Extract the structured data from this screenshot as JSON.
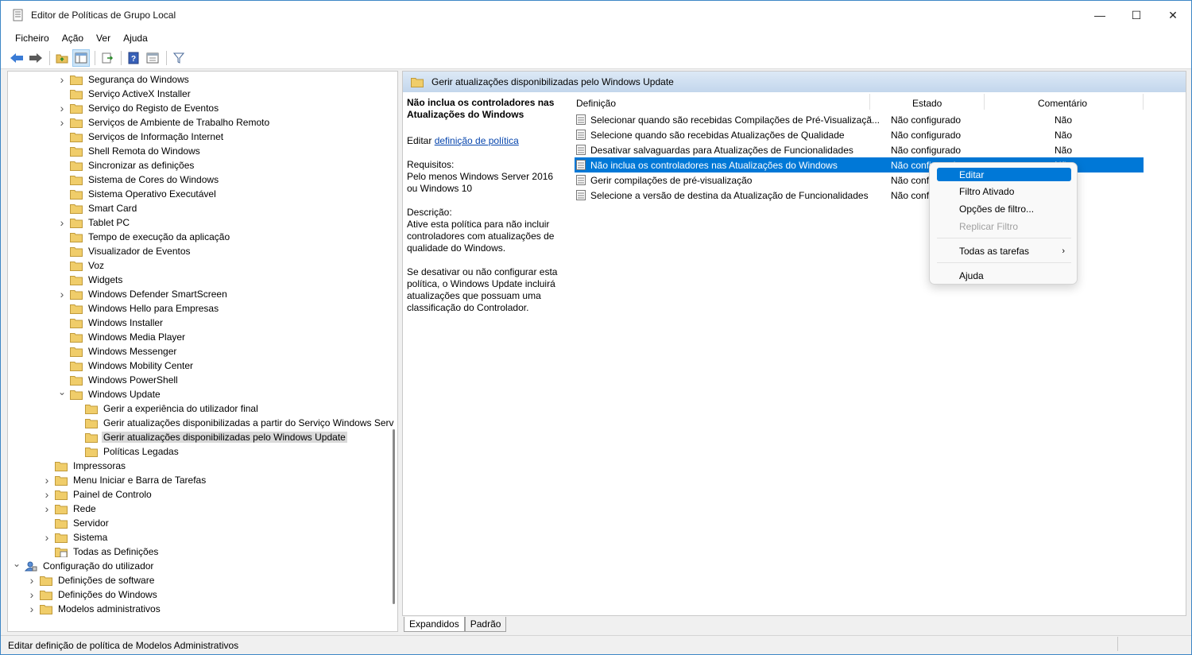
{
  "window": {
    "title": "Editor de Políticas de Grupo Local",
    "controls": [
      "—",
      "☐",
      "✕"
    ]
  },
  "menubar": {
    "items": [
      "Ficheiro",
      "Ação",
      "Ver",
      "Ajuda"
    ]
  },
  "tree": {
    "items": [
      {
        "label": "Segurança do Windows",
        "expandable": true,
        "level": 3
      },
      {
        "label": "Serviço ActiveX Installer",
        "expandable": false,
        "level": 3
      },
      {
        "label": "Serviço do Registo de Eventos",
        "expandable": true,
        "level": 3
      },
      {
        "label": "Serviços de Ambiente de Trabalho Remoto",
        "expandable": true,
        "level": 3
      },
      {
        "label": "Serviços de Informação Internet",
        "expandable": false,
        "level": 3
      },
      {
        "label": "Shell Remota do Windows",
        "expandable": false,
        "level": 3
      },
      {
        "label": "Sincronizar as definições",
        "expandable": false,
        "level": 3
      },
      {
        "label": "Sistema de Cores do Windows",
        "expandable": false,
        "level": 3
      },
      {
        "label": "Sistema Operativo Executável",
        "expandable": false,
        "level": 3
      },
      {
        "label": "Smart Card",
        "expandable": false,
        "level": 3
      },
      {
        "label": "Tablet PC",
        "expandable": true,
        "level": 3
      },
      {
        "label": "Tempo de execução da aplicação",
        "expandable": false,
        "level": 3
      },
      {
        "label": "Visualizador de Eventos",
        "expandable": false,
        "level": 3
      },
      {
        "label": "Voz",
        "expandable": false,
        "level": 3
      },
      {
        "label": "Widgets",
        "expandable": false,
        "level": 3
      },
      {
        "label": "Windows Defender SmartScreen",
        "expandable": true,
        "level": 3
      },
      {
        "label": "Windows Hello para Empresas",
        "expandable": false,
        "level": 3
      },
      {
        "label": "Windows Installer",
        "expandable": false,
        "level": 3
      },
      {
        "label": "Windows Media Player",
        "expandable": false,
        "level": 3
      },
      {
        "label": "Windows Messenger",
        "expandable": false,
        "level": 3
      },
      {
        "label": "Windows Mobility Center",
        "expandable": false,
        "level": 3
      },
      {
        "label": "Windows PowerShell",
        "expandable": false,
        "level": 3
      },
      {
        "label": "Windows Update",
        "expandable": true,
        "expanded": true,
        "level": 3
      },
      {
        "label": "Gerir a experiência do utilizador final",
        "expandable": false,
        "level": 4
      },
      {
        "label": "Gerir atualizações disponibilizadas a partir do Serviço Windows Serv",
        "expandable": false,
        "level": 4
      },
      {
        "label": "Gerir atualizações disponibilizadas pelo Windows Update",
        "expandable": false,
        "level": 4,
        "selected": true
      },
      {
        "label": "Políticas Legadas",
        "expandable": false,
        "level": 4
      },
      {
        "label": "Impressoras",
        "expandable": false,
        "level": 2
      },
      {
        "label": "Menu Iniciar e Barra de Tarefas",
        "expandable": true,
        "level": 2
      },
      {
        "label": "Painel de Controlo",
        "expandable": true,
        "level": 2
      },
      {
        "label": "Rede",
        "expandable": true,
        "level": 2
      },
      {
        "label": "Servidor",
        "expandable": false,
        "level": 2
      },
      {
        "label": "Sistema",
        "expandable": true,
        "level": 2
      },
      {
        "label": "Todas as Definições",
        "expandable": false,
        "level": 2,
        "icon": "settings-folder-icon"
      },
      {
        "label": "Configuração do utilizador",
        "expandable": true,
        "expanded": true,
        "level": 0,
        "icon": "user-config-icon"
      },
      {
        "label": "Definições de software",
        "expandable": true,
        "level": 1
      },
      {
        "label": "Definições do Windows",
        "expandable": true,
        "level": 1
      },
      {
        "label": "Modelos administrativos",
        "expandable": true,
        "level": 1
      }
    ]
  },
  "right": {
    "header": "Gerir atualizações disponibilizadas pelo Windows Update",
    "description": {
      "title": "Não inclua os controladores nas Atualizações do Windows",
      "edit_prefix": "Editar ",
      "edit_link": "definição de política",
      "requirements_label": "Requisitos:",
      "requirements": "Pelo menos Windows Server 2016 ou Windows 10",
      "description_label": "Descrição:",
      "description": "Ative esta política para não incluir controladores com atualizações de qualidade do Windows.",
      "description2": "Se desativar ou não configurar esta política, o Windows Update incluirá atualizações que possuam uma classificação do Controlador."
    },
    "columns": {
      "definition": "Definição",
      "state": "Estado",
      "comment": "Comentário"
    },
    "rows": [
      {
        "name": "Selecionar quando são recebidas Compilações de Pré-Visualizaçã...",
        "state": "Não configurado",
        "comment": "Não"
      },
      {
        "name": "Selecione quando são recebidas Atualizações de Qualidade",
        "state": "Não configurado",
        "comment": "Não"
      },
      {
        "name": "Desativar salvaguardas para Atualizações de Funcionalidades",
        "state": "Não configurado",
        "comment": "Não"
      },
      {
        "name": "Não inclua os controladores nas Atualizações do Windows",
        "state": "Não configurado",
        "comment": "Não",
        "selected": true
      },
      {
        "name": "Gerir compilações de pré-visualização",
        "state": "Não configurado",
        "comment": "Não"
      },
      {
        "name": "Selecione a versão de destina da Atualização de Funcionalidades",
        "state": "Não configurado",
        "comment": "Não"
      }
    ]
  },
  "tabs": [
    "Expandidos",
    "Padrão"
  ],
  "context_menu": {
    "items": [
      {
        "label": "Editar",
        "selected": true
      },
      {
        "label": "Filtro Ativado"
      },
      {
        "label": "Opções de filtro..."
      },
      {
        "label": "Replicar Filtro",
        "disabled": true
      },
      {
        "label": "Todas as tarefas",
        "submenu": true
      },
      {
        "label": "Ajuda"
      }
    ]
  },
  "statusbar": {
    "text": "Editar definição de política de Modelos Administrativos"
  },
  "colors": {
    "selection": "#0078d7",
    "folder": "#e8c15c",
    "header_gradient": "#c3d6ec"
  }
}
